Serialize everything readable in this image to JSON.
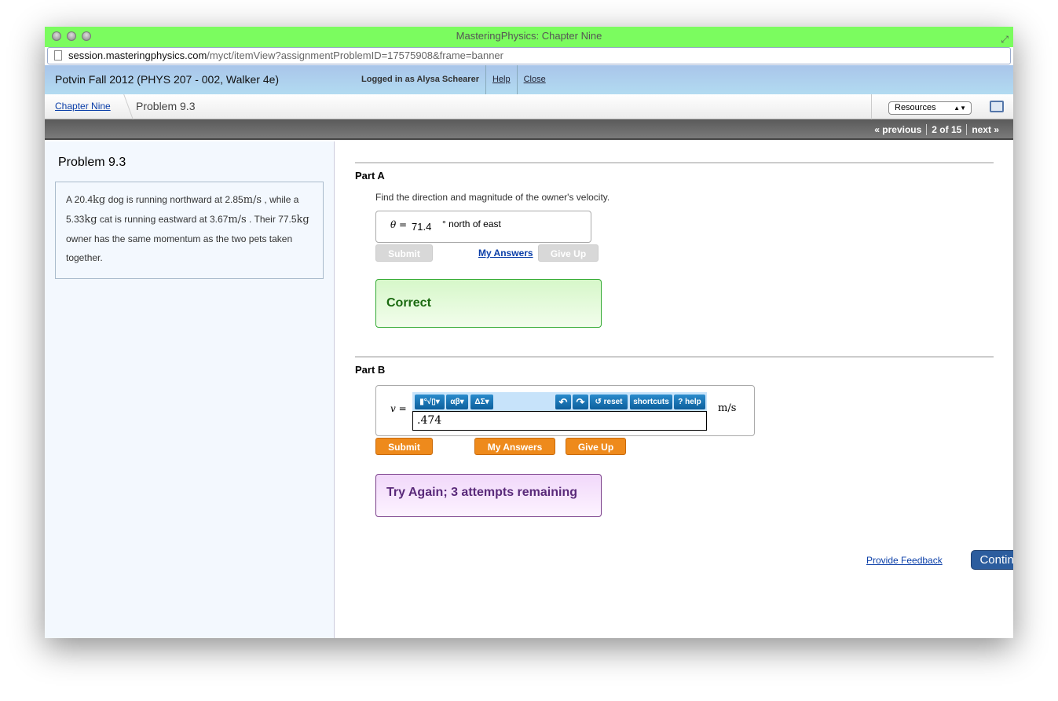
{
  "window": {
    "title": "MasteringPhysics: Chapter Nine",
    "url_domain": "session.masteringphysics.com",
    "url_path": "/myct/itemView?assignmentProblemID=17575908&frame=banner"
  },
  "header": {
    "course": "Potvin Fall 2012 (PHYS 207 - 002, Walker 4e)",
    "logged_in": "Logged in as Alysa Schearer",
    "help": "Help",
    "close": "Close"
  },
  "breadcrumb": {
    "chapter": "Chapter Nine",
    "problem": "Problem 9.3",
    "resources": "Resources"
  },
  "pager": {
    "previous": "« previous",
    "position": "2 of 15",
    "next": "next »"
  },
  "problem": {
    "title": "Problem 9.3",
    "t1": "A 20.4",
    "u1": "kg",
    "t2": " dog is running northward at 2.85",
    "u2": "m/s",
    "t3": " , while a 5.33",
    "u3": "kg",
    "t4": " cat is running eastward at 3.67",
    "u4": "m/s",
    "t5": " . Their 77.5",
    "u5": "kg",
    "t6": " owner has the same momentum as the two pets taken together."
  },
  "partA": {
    "label": "Part A",
    "question": "Find the direction and magnitude of the owner's velocity.",
    "var": "θ =",
    "value": "71.4",
    "unit": "° north of east",
    "submit": "Submit",
    "my_answers": "My Answers",
    "give_up": "Give Up",
    "feedback": "Correct"
  },
  "partB": {
    "label": "Part B",
    "var": "v =",
    "value": ".474",
    "unit": "m/s",
    "toolbar": {
      "templates": "▮°√▯▾",
      "greek": "αβ▾",
      "symbols": "ΔΣ▾",
      "undo": "↶",
      "redo": "↷",
      "reset": "↺ reset",
      "shortcuts": "shortcuts",
      "help": "? help"
    },
    "submit": "Submit",
    "my_answers": "My Answers",
    "give_up": "Give Up",
    "feedback": "Try Again; 3 attempts remaining"
  },
  "footer": {
    "feedback": "Provide Feedback",
    "continue": "Continue"
  }
}
